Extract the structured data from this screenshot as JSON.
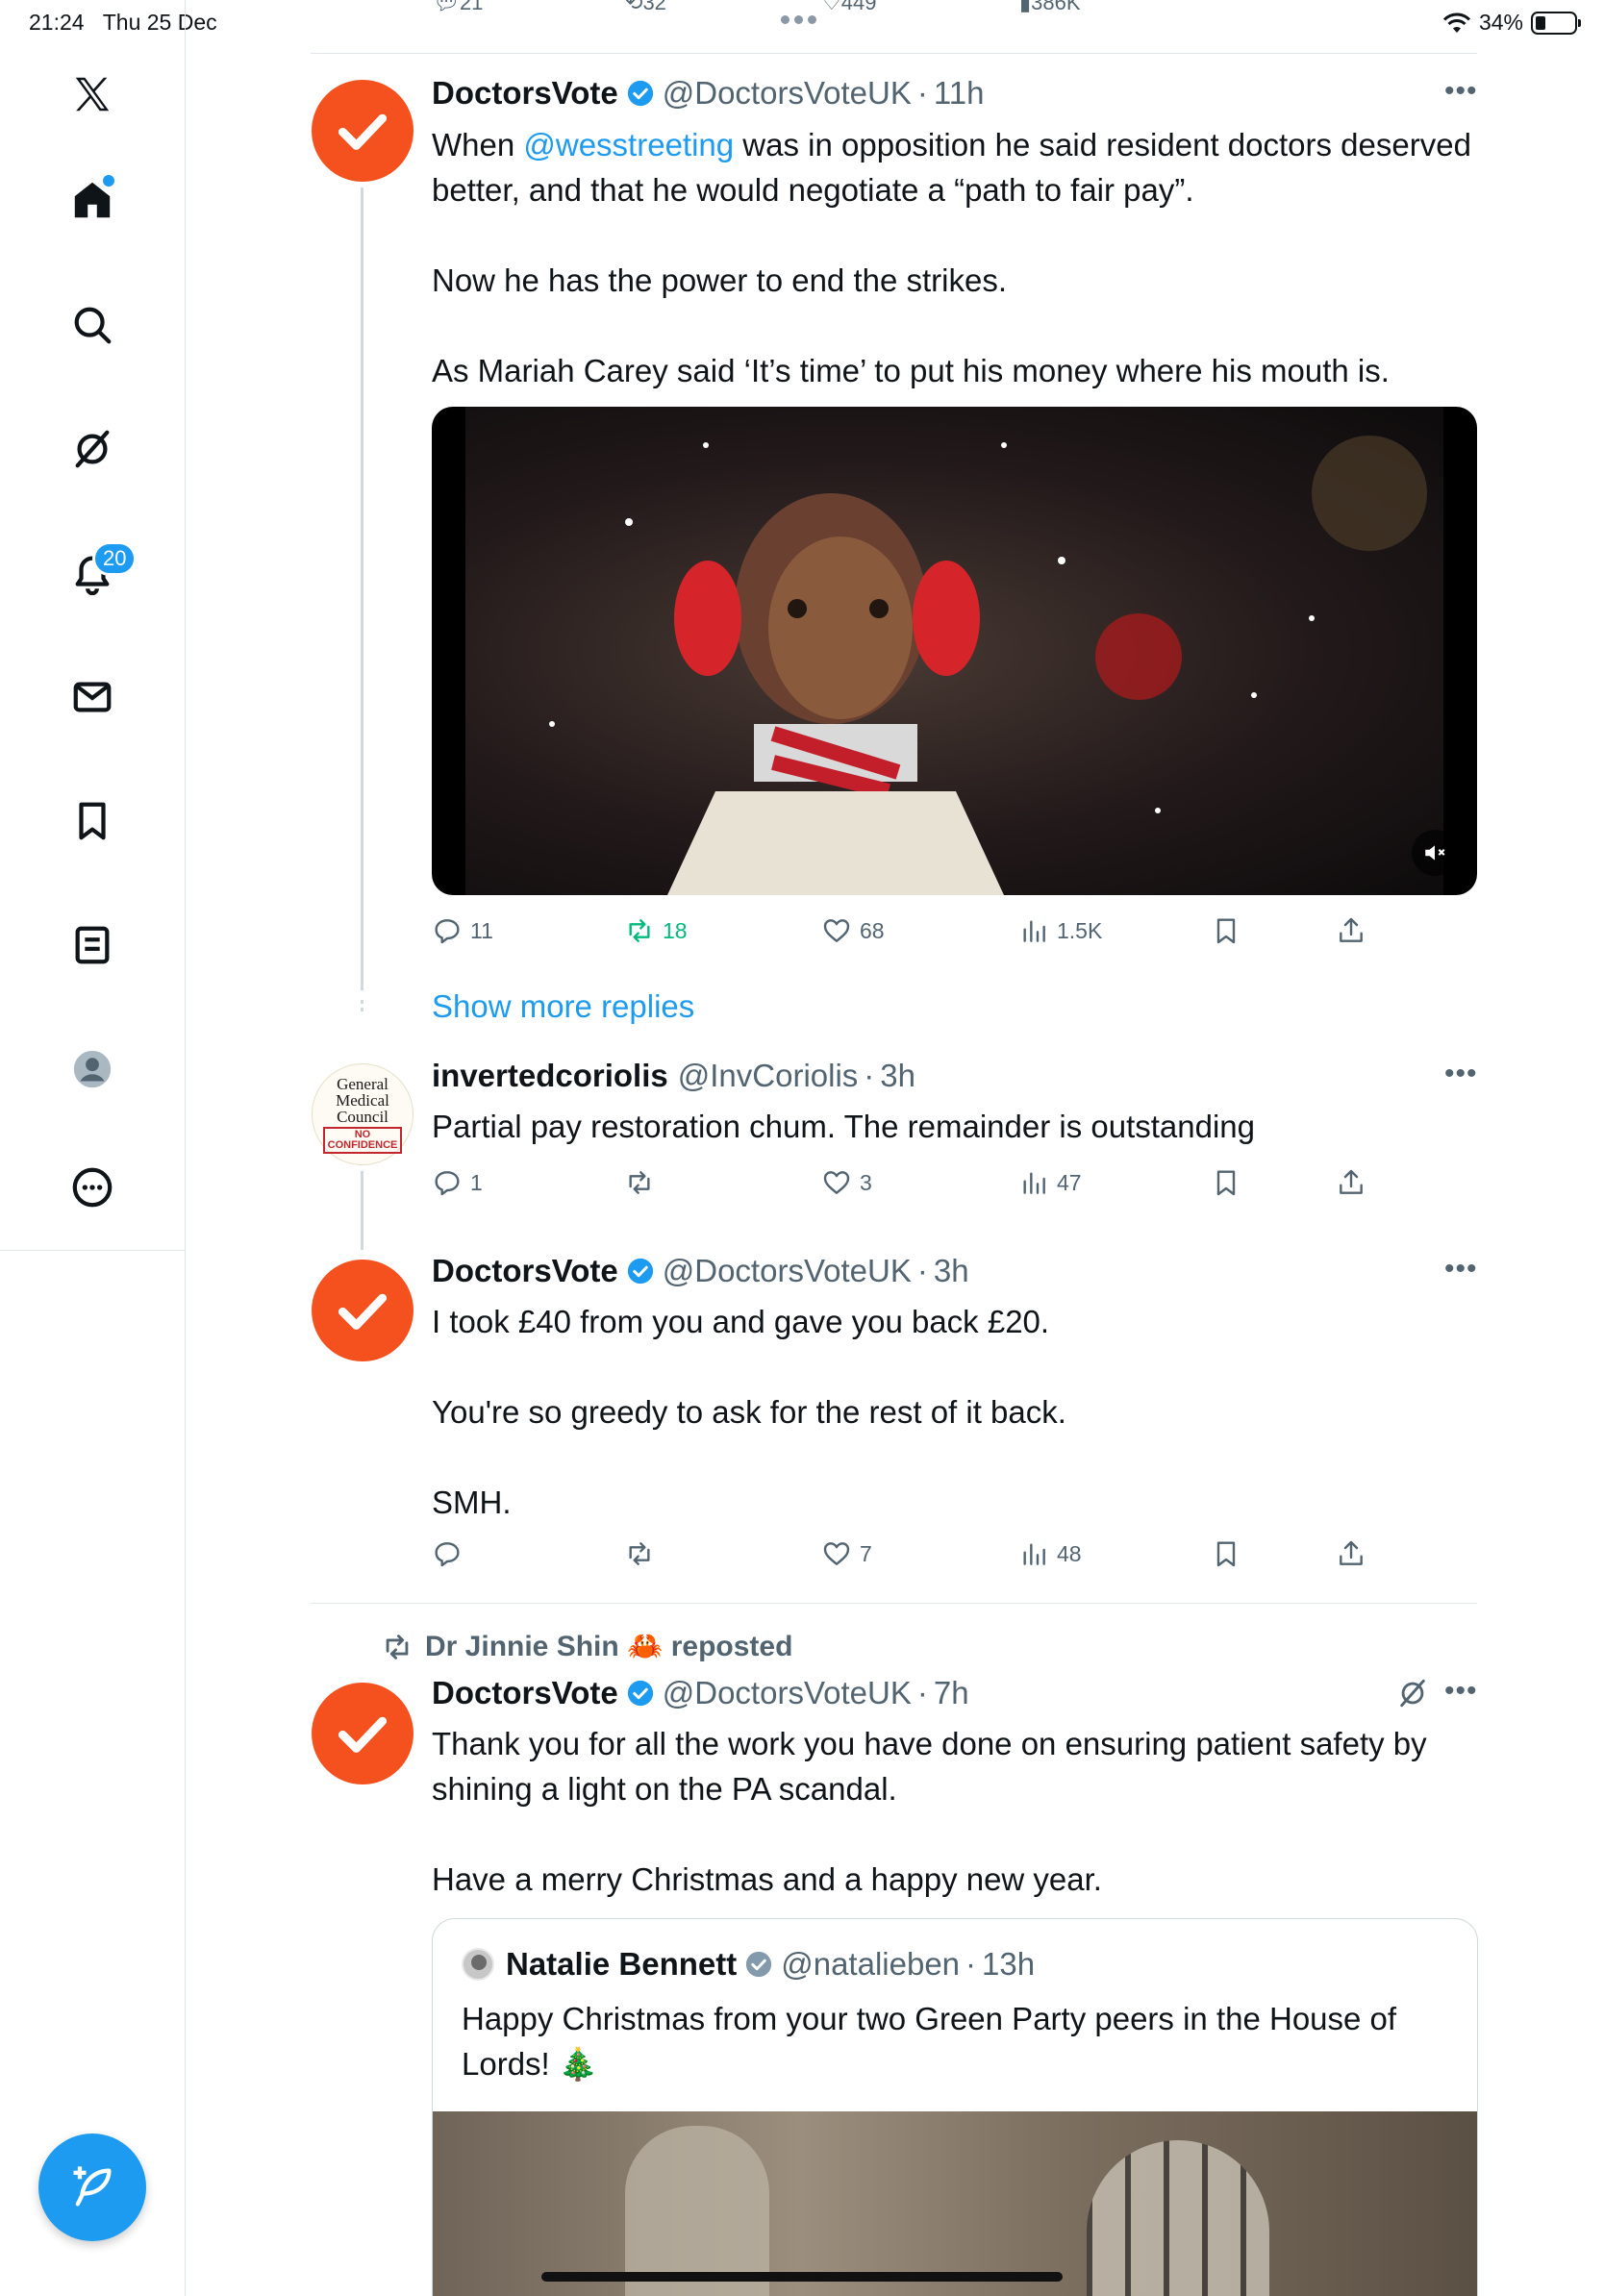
{
  "status_bar": {
    "time": "21:24",
    "date": "Thu 25 Dec",
    "battery": "34%"
  },
  "sidebar": {
    "items": [
      {
        "name": "x-logo-icon"
      },
      {
        "name": "home-icon"
      },
      {
        "name": "search-icon"
      },
      {
        "name": "grok-icon"
      },
      {
        "name": "notifications-icon"
      },
      {
        "name": "messages-icon"
      },
      {
        "name": "bookmarks-icon"
      },
      {
        "name": "lists-icon"
      },
      {
        "name": "profile-icon"
      },
      {
        "name": "more-icon"
      }
    ],
    "notification_count": "20"
  },
  "prev_tweet_actions": {
    "replies": "21",
    "reposts": "32",
    "likes": "449",
    "views": "386K"
  },
  "tweets": [
    {
      "name": "DoctorsVote",
      "handle": "@DoctorsVoteUK",
      "time": "11h",
      "text_pre": "When ",
      "mention": "@wesstreeting",
      "text_post": " was in opposition he said resident doctors deserved better, and that he would negotiate a “path to fair pay”.\n\nNow he has the power to end the strikes.\n\nAs Mariah Carey said ‘It’s time’ to put his money where his mouth is.",
      "replies": "11",
      "reposts": "18",
      "likes": "68",
      "views": "1.5K"
    },
    {
      "name": "invertedcoriolis",
      "handle": "@InvCoriolis",
      "time": "3h",
      "text": "Partial pay restoration chum. The remainder is outstanding",
      "replies": "1",
      "reposts": "",
      "likes": "3",
      "views": "47",
      "avatar_text": [
        "General",
        "Medical",
        "Council"
      ],
      "avatar_badge": [
        "NO",
        "CONFIDENCE"
      ]
    },
    {
      "name": "DoctorsVote",
      "handle": "@DoctorsVoteUK",
      "time": "3h",
      "text": "I took £40 from you and gave you back £20.\n\nYou're so greedy to ask for the rest of it back.\n\nSMH.",
      "replies": "",
      "reposts": "",
      "likes": "7",
      "views": "48"
    },
    {
      "repost_by": "Dr Jinnie Shin 🦀 reposted",
      "name": "DoctorsVote",
      "handle": "@DoctorsVoteUK",
      "time": "7h",
      "text": "Thank you for all the work you have done on ensuring patient safety by shining a light on the PA scandal.\n\nHave a merry Christmas and a happy new year.",
      "quote": {
        "name": "Natalie Bennett",
        "handle": "@natalieben",
        "time": "13h",
        "text": "Happy Christmas from your two Green Party peers in the House of Lords! 🎄"
      }
    }
  ],
  "show_more_replies": "Show more replies",
  "colors": {
    "accent": "#1d9bf0",
    "repost_green": "#00ba7c",
    "avatar_orange": "#f4511e",
    "muted": "#536471"
  }
}
